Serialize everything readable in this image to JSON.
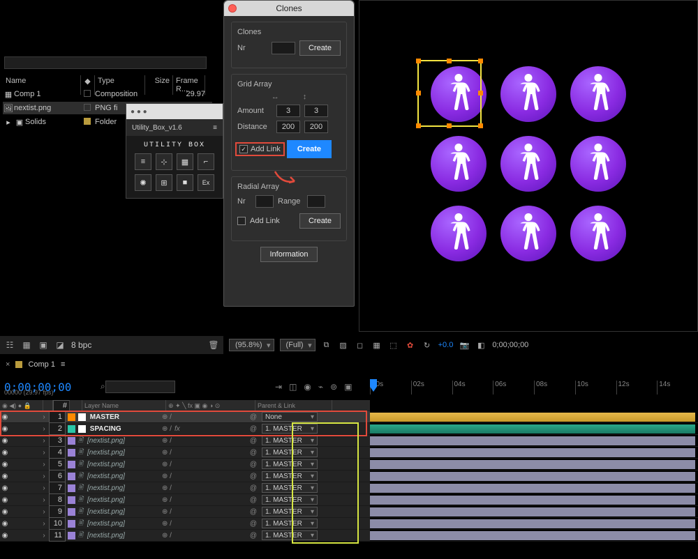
{
  "project": {
    "search_placeholder": "",
    "columns": {
      "name": "Name",
      "tag": "◆",
      "type": "Type",
      "size": "Size",
      "frame": "Frame R..."
    },
    "rows": [
      {
        "icon": "comp",
        "name": "Comp 1",
        "label": "none",
        "type": "Composition",
        "size": "",
        "fr": "29.97"
      },
      {
        "icon": "png",
        "name": "nextist.png",
        "label": "none",
        "type": "PNG fi",
        "size": "",
        "fr": ""
      },
      {
        "icon": "folder",
        "name": "Solids",
        "label": "yellow",
        "type": "Folder",
        "size": "",
        "fr": ""
      }
    ]
  },
  "utilbox": {
    "window_title": "",
    "title": "Utility_Box_v1.6",
    "logo": "UTILITY BOX",
    "icons": [
      "align",
      "anchor",
      "grid",
      "path",
      "sun",
      "tile",
      "cam",
      "Ex"
    ]
  },
  "clones": {
    "title": "Clones",
    "sec_clones": "Clones",
    "nr_label": "Nr",
    "nr_value": "",
    "create": "Create",
    "sec_grid": "Grid Array",
    "amount_label": "Amount",
    "amount_x": "3",
    "amount_y": "3",
    "distance_label": "Distance",
    "distance_x": "200",
    "distance_y": "200",
    "addlink_label": "Add Link",
    "grid_create": "Create",
    "sec_radial": "Radial Array",
    "radial_nr_label": "Nr",
    "radial_nr": "",
    "range_label": "Range",
    "range": "",
    "radial_addlink": "Add Link",
    "radial_create": "Create",
    "information": "Information"
  },
  "preview_controls": {
    "zoom": "(95.8%)",
    "res": "(Full)",
    "exposure": "+0.0",
    "timecode": "0;00;00;00"
  },
  "proj_footer": {
    "bpc": "8 bpc"
  },
  "timeline": {
    "tab": "Comp 1",
    "timecode": "0;00;00;00",
    "fps": "00000 (29.97 fps)",
    "ruler": [
      "00s",
      "02s",
      "04s",
      "06s",
      "08s",
      "10s",
      "12s",
      "14s"
    ],
    "header": {
      "num": "#",
      "name": "Layer Name",
      "sw": "⊕ ✦ ╲ fx ▣ ◉ ◑ ⊙",
      "parent": "Parent & Link"
    },
    "layers": [
      {
        "n": 1,
        "color": "#ff8a00",
        "sq": "#fff",
        "name": "MASTER",
        "ital": false,
        "fx": false,
        "parent": "None",
        "sel": true,
        "kind": "master"
      },
      {
        "n": 2,
        "color": "#2ac7a8",
        "sq": "#fff",
        "name": "SPACING",
        "ital": false,
        "fx": true,
        "parent": "1. MASTER",
        "sel": false,
        "kind": "spacing"
      },
      {
        "n": 3,
        "color": "#9a82d6",
        "sq": "",
        "name": "[nextist.png]",
        "ital": true,
        "fx": false,
        "parent": "1. MASTER",
        "sel": false,
        "kind": "png"
      },
      {
        "n": 4,
        "color": "#9a82d6",
        "sq": "",
        "name": "[nextist.png]",
        "ital": true,
        "fx": false,
        "parent": "1. MASTER",
        "sel": false,
        "kind": "png"
      },
      {
        "n": 5,
        "color": "#9a82d6",
        "sq": "",
        "name": "[nextist.png]",
        "ital": true,
        "fx": false,
        "parent": "1. MASTER",
        "sel": false,
        "kind": "png"
      },
      {
        "n": 6,
        "color": "#9a82d6",
        "sq": "",
        "name": "[nextist.png]",
        "ital": true,
        "fx": false,
        "parent": "1. MASTER",
        "sel": false,
        "kind": "png"
      },
      {
        "n": 7,
        "color": "#9a82d6",
        "sq": "",
        "name": "[nextist.png]",
        "ital": true,
        "fx": false,
        "parent": "1. MASTER",
        "sel": false,
        "kind": "png"
      },
      {
        "n": 8,
        "color": "#9a82d6",
        "sq": "",
        "name": "[nextist.png]",
        "ital": true,
        "fx": false,
        "parent": "1. MASTER",
        "sel": false,
        "kind": "png"
      },
      {
        "n": 9,
        "color": "#9a82d6",
        "sq": "",
        "name": "[nextist.png]",
        "ital": true,
        "fx": false,
        "parent": "1. MASTER",
        "sel": false,
        "kind": "png"
      },
      {
        "n": 10,
        "color": "#9a82d6",
        "sq": "",
        "name": "[nextist.png]",
        "ital": true,
        "fx": false,
        "parent": "1. MASTER",
        "sel": false,
        "kind": "png"
      },
      {
        "n": 11,
        "color": "#9a82d6",
        "sq": "",
        "name": "[nextist.png]",
        "ital": true,
        "fx": false,
        "parent": "1. MASTER",
        "sel": false,
        "kind": "png"
      }
    ]
  }
}
